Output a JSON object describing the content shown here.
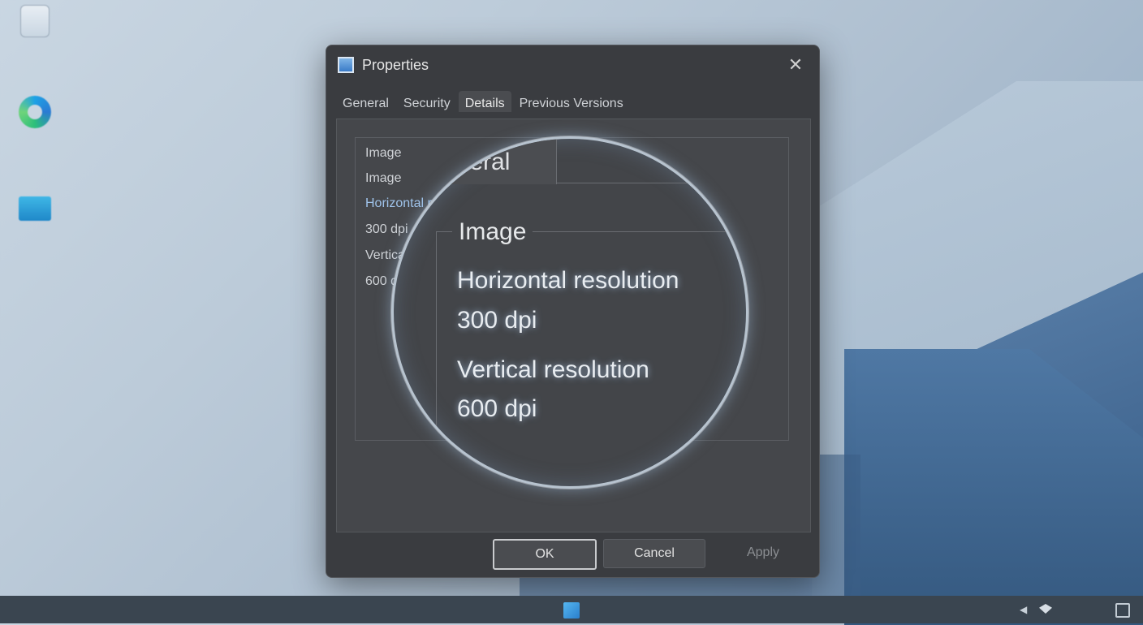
{
  "window": {
    "title": "Properties",
    "close_glyph": "✕"
  },
  "tabs": [
    {
      "label": "General"
    },
    {
      "label": "Security"
    },
    {
      "label": "Details",
      "active": true
    },
    {
      "label": "Previous Versions"
    }
  ],
  "details": {
    "section_header": "Image",
    "rows": [
      {
        "label": "Image"
      },
      {
        "label": "Horizontal resolution"
      },
      {
        "label": "300 dpi"
      },
      {
        "label": "Vertical resolution"
      },
      {
        "label": "600 dpi"
      }
    ]
  },
  "magnifier": {
    "tab_label": "eneral",
    "section_label": "Image",
    "horizontal_label": "Horizontal resolution",
    "horizontal_value": "300 dpi",
    "vertical_label": "Vertical resolution",
    "vertical_value": "600 dpi"
  },
  "buttons": {
    "ok": "OK",
    "cancel": "Cancel",
    "apply": "Apply"
  },
  "desktop_icons": [
    {
      "name": "recycle-bin-icon"
    },
    {
      "name": "edge-icon"
    },
    {
      "name": "this-pc-icon"
    }
  ],
  "colors": {
    "dialog_bg": "#3a3c40",
    "accent_text": "#9fc3ea",
    "taskbar": "#3a4550"
  }
}
